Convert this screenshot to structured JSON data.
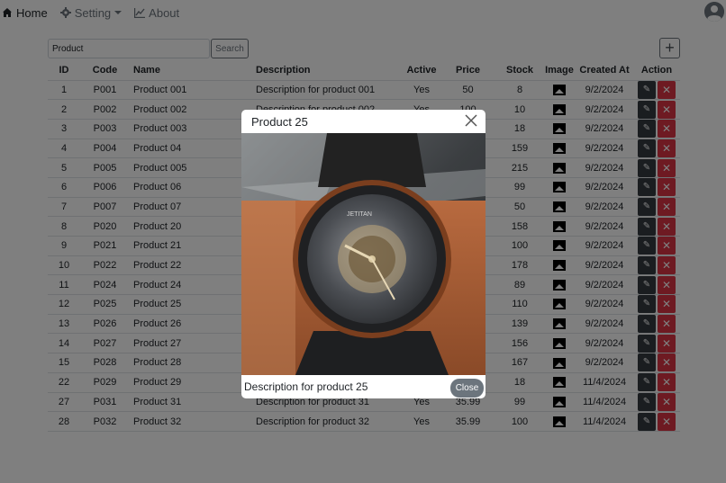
{
  "nav": {
    "home": "Home",
    "setting": "Setting",
    "about": "About"
  },
  "search": {
    "placeholder": "Product",
    "button": "Search"
  },
  "table": {
    "headers": [
      "ID",
      "Code",
      "Name",
      "Description",
      "Active",
      "Price",
      "Stock",
      "Image",
      "Created At",
      "Action"
    ],
    "rows": [
      {
        "id": "1",
        "code": "P001",
        "name": "Product 001",
        "description": "Description for product 001",
        "active": "Yes",
        "price": "50",
        "stock": "8",
        "created": "9/2/2024"
      },
      {
        "id": "2",
        "code": "P002",
        "name": "Product 002",
        "description": "Description for product 002",
        "active": "Yes",
        "price": "100",
        "stock": "10",
        "created": "9/2/2024"
      },
      {
        "id": "3",
        "code": "P003",
        "name": "Product 003",
        "description": "",
        "active": "",
        "price": "",
        "stock": "18",
        "created": "9/2/2024"
      },
      {
        "id": "4",
        "code": "P004",
        "name": "Product 04",
        "description": "",
        "active": "",
        "price": "",
        "stock": "159",
        "created": "9/2/2024"
      },
      {
        "id": "5",
        "code": "P005",
        "name": "Product 005",
        "description": "",
        "active": "",
        "price": "",
        "stock": "215",
        "created": "9/2/2024"
      },
      {
        "id": "6",
        "code": "P006",
        "name": "Product 06",
        "description": "",
        "active": "",
        "price": "",
        "stock": "99",
        "created": "9/2/2024"
      },
      {
        "id": "7",
        "code": "P007",
        "name": "Product 07",
        "description": "",
        "active": "",
        "price": "",
        "stock": "50",
        "created": "9/2/2024"
      },
      {
        "id": "8",
        "code": "P020",
        "name": "Product 20",
        "description": "",
        "active": "",
        "price": "",
        "stock": "158",
        "created": "9/2/2024"
      },
      {
        "id": "9",
        "code": "P021",
        "name": "Product 21",
        "description": "",
        "active": "",
        "price": "",
        "stock": "100",
        "created": "9/2/2024"
      },
      {
        "id": "10",
        "code": "P022",
        "name": "Product 22",
        "description": "",
        "active": "",
        "price": "",
        "stock": "178",
        "created": "9/2/2024"
      },
      {
        "id": "11",
        "code": "P024",
        "name": "Product 24",
        "description": "",
        "active": "",
        "price": "",
        "stock": "89",
        "created": "9/2/2024"
      },
      {
        "id": "12",
        "code": "P025",
        "name": "Product 25",
        "description": "",
        "active": "",
        "price": "",
        "stock": "110",
        "created": "9/2/2024"
      },
      {
        "id": "13",
        "code": "P026",
        "name": "Product 26",
        "description": "",
        "active": "",
        "price": "",
        "stock": "139",
        "created": "9/2/2024"
      },
      {
        "id": "14",
        "code": "P027",
        "name": "Product 27",
        "description": "",
        "active": "",
        "price": "",
        "stock": "156",
        "created": "9/2/2024"
      },
      {
        "id": "15",
        "code": "P028",
        "name": "Product 28",
        "description": "",
        "active": "",
        "price": "",
        "stock": "167",
        "created": "9/2/2024"
      },
      {
        "id": "22",
        "code": "P029",
        "name": "Product 29",
        "description": "",
        "active": "",
        "price": "",
        "stock": "18",
        "created": "11/4/2024"
      },
      {
        "id": "27",
        "code": "P031",
        "name": "Product 31",
        "description": "Description for product 31",
        "active": "Yes",
        "price": "35.99",
        "stock": "99",
        "created": "11/4/2024"
      },
      {
        "id": "28",
        "code": "P032",
        "name": "Product 32",
        "description": "Description for product 32",
        "active": "Yes",
        "price": "35.99",
        "stock": "100",
        "created": "11/4/2024"
      }
    ]
  },
  "modal": {
    "title": "Product 25",
    "description": "Description for product 25",
    "close_button": "Close",
    "image_text": "JETITAN"
  },
  "colors": {
    "overlay": "rgba(0,0,0,0.5)",
    "edit": "#343a40",
    "delete": "#dc3545",
    "close": "#6c757d"
  }
}
